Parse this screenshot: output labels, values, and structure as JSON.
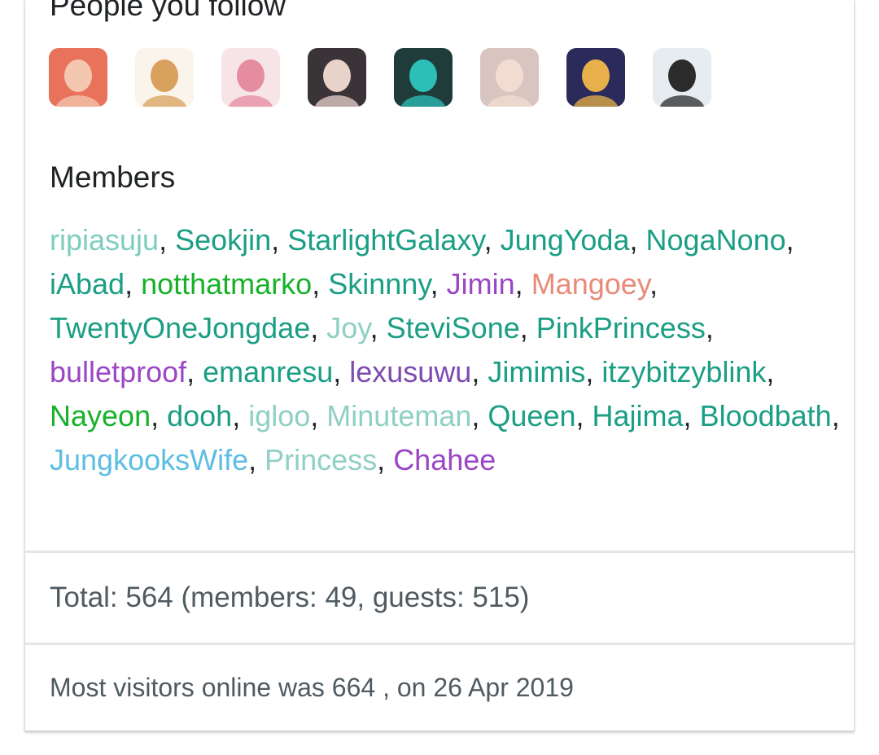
{
  "following": {
    "title": "People you follow",
    "avatars": [
      {
        "icon": "red-haired-girl-avatar",
        "bg": "#e8735a",
        "fg": "#f3c7b0"
      },
      {
        "icon": "anime-chibi-girl-avatar",
        "bg": "#fbf4ea",
        "fg": "#d9a15e"
      },
      {
        "icon": "pink-lips-avatar",
        "bg": "#f7e4e6",
        "fg": "#e58ca0"
      },
      {
        "icon": "dark-haired-girl-avatar",
        "bg": "#3a3338",
        "fg": "#e8d3cb"
      },
      {
        "icon": "teal-haired-boy-avatar",
        "bg": "#1f3c3b",
        "fg": "#2bbfb8"
      },
      {
        "icon": "girl-portrait-avatar",
        "bg": "#d8c5c0",
        "fg": "#f2dcd2"
      },
      {
        "icon": "anime-boy-avatar",
        "bg": "#2a2b5a",
        "fg": "#e8b04a"
      },
      {
        "icon": "boy-portrait-avatar",
        "bg": "#e6ecef",
        "fg": "#2b2b2b"
      }
    ]
  },
  "members": {
    "title": "Members",
    "separator": ", ",
    "list": [
      {
        "name": "ripiasuju",
        "color": "#7ecdc0"
      },
      {
        "name": "Seokjin",
        "color": "#1a9e84"
      },
      {
        "name": "StarlightGalaxy",
        "color": "#1a9e84"
      },
      {
        "name": "JungYoda",
        "color": "#1a9e84"
      },
      {
        "name": "NogaNono",
        "color": "#1a9e84"
      },
      {
        "name": "iAbad",
        "color": "#1a9e84"
      },
      {
        "name": "notthatmarko",
        "color": "#17b12a"
      },
      {
        "name": "Skinnny",
        "color": "#1a9e84"
      },
      {
        "name": "Jimin",
        "color": "#9b46c4"
      },
      {
        "name": "Mangoey",
        "color": "#e88a78"
      },
      {
        "name": "TwentyOneJongdae",
        "color": "#1a9e84"
      },
      {
        "name": "Joy",
        "color": "#8fd0c4"
      },
      {
        "name": "SteviSone",
        "color": "#1a9e84"
      },
      {
        "name": "PinkPrincess",
        "color": "#1a9e84"
      },
      {
        "name": "bulletproof",
        "color": "#9b46c4"
      },
      {
        "name": "emanresu",
        "color": "#1a9e84"
      },
      {
        "name": "lexusuwu",
        "color": "#7d4bb0"
      },
      {
        "name": "Jimimis",
        "color": "#1a9e84"
      },
      {
        "name": "itzybitzyblink",
        "color": "#1a9e84"
      },
      {
        "name": "Nayeon",
        "color": "#17b12a"
      },
      {
        "name": "dooh",
        "color": "#1a9e84"
      },
      {
        "name": "igloo",
        "color": "#8fd0c4"
      },
      {
        "name": "Minuteman",
        "color": "#8fd0c4"
      },
      {
        "name": "Queen",
        "color": "#1a9e84"
      },
      {
        "name": "Hajima",
        "color": "#1a9e84"
      },
      {
        "name": "Bloodbath",
        "color": "#1a9e84"
      },
      {
        "name": "JungkooksWife",
        "color": "#5dbde3"
      },
      {
        "name": "Princess",
        "color": "#8fd0c4"
      },
      {
        "name": "Chahee",
        "color": "#9b46c4"
      }
    ]
  },
  "stats": {
    "total": "Total: 564 (members: 49, guests: 515)",
    "most_visitors": "Most visitors online was 664 , on 26 Apr 2019"
  }
}
